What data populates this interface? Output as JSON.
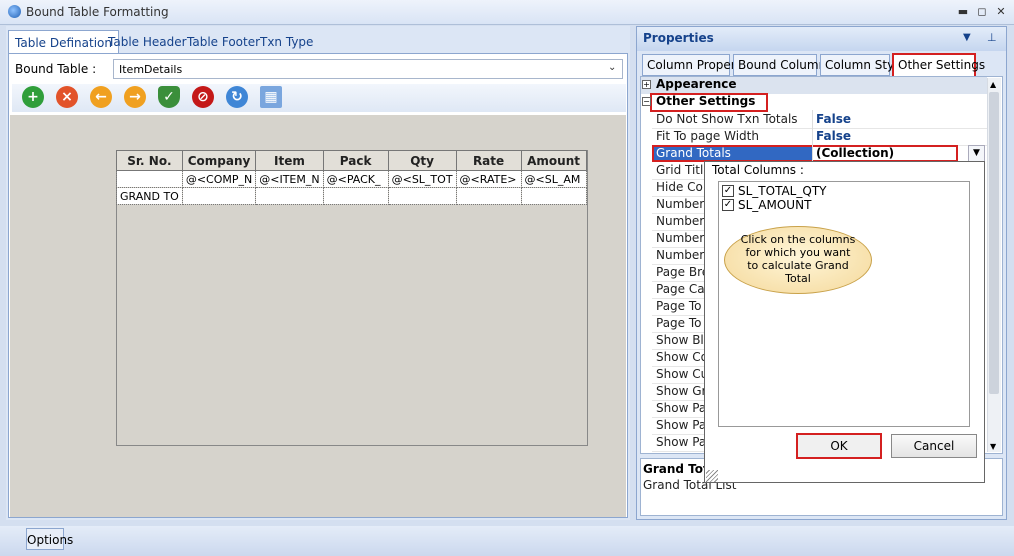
{
  "window": {
    "title": "Bound Table Formatting"
  },
  "left": {
    "tabs": [
      "Table Defination",
      "Table Header",
      "Table Footer",
      "Txn Type"
    ],
    "bound_table_label": "Bound Table :",
    "bound_table_value": "ItemDetails",
    "table": {
      "headers": [
        "Sr. No.",
        "Company",
        "Item",
        "Pack",
        "Qty",
        "Rate",
        "Amount"
      ],
      "rows": [
        [
          "",
          "@<COMP_N",
          "@<ITEM_N",
          "@<PACK_",
          "@<SL_TOT",
          "@<RATE>",
          "@<SL_AM"
        ],
        [
          "GRAND TO",
          "",
          "",
          "",
          "",
          "",
          ""
        ]
      ]
    }
  },
  "properties": {
    "title": "Properties",
    "tabs": [
      "Column Property",
      "Bound Columns",
      "Column Style",
      "Other Settings"
    ],
    "categories": [
      "Appearence",
      "Other Settings"
    ],
    "rows": [
      {
        "name": "Do Not Show Txn Totals",
        "value": "False"
      },
      {
        "name": "Fit To page Width",
        "value": "False"
      },
      {
        "name": "Grand Totals",
        "value": "(Collection)"
      }
    ],
    "truncated_rows": [
      "Grid Title",
      "Hide Col",
      "Number",
      "Number",
      "Number",
      "Number",
      "Page Bre",
      "Page Ca",
      "Page To",
      "Page To",
      "Show Bl",
      "Show Co",
      "Show Cu",
      "Show Gr",
      "Show Pa",
      "Show Pa",
      "Show Pa"
    ],
    "description": {
      "title": "Grand Totals",
      "text": "Grand Total List"
    }
  },
  "dropdown": {
    "title": "Total Columns :",
    "items": [
      {
        "label": "SL_TOTAL_QTY",
        "checked": true
      },
      {
        "label": "SL_AMOUNT",
        "checked": true
      }
    ],
    "callout": "Click on the columns for which  you want to calculate Grand Total",
    "ok": "OK",
    "cancel": "Cancel"
  },
  "status": {
    "options": "Options"
  },
  "colors": {
    "accent": "#15428b",
    "highlight_red": "#d42020"
  }
}
